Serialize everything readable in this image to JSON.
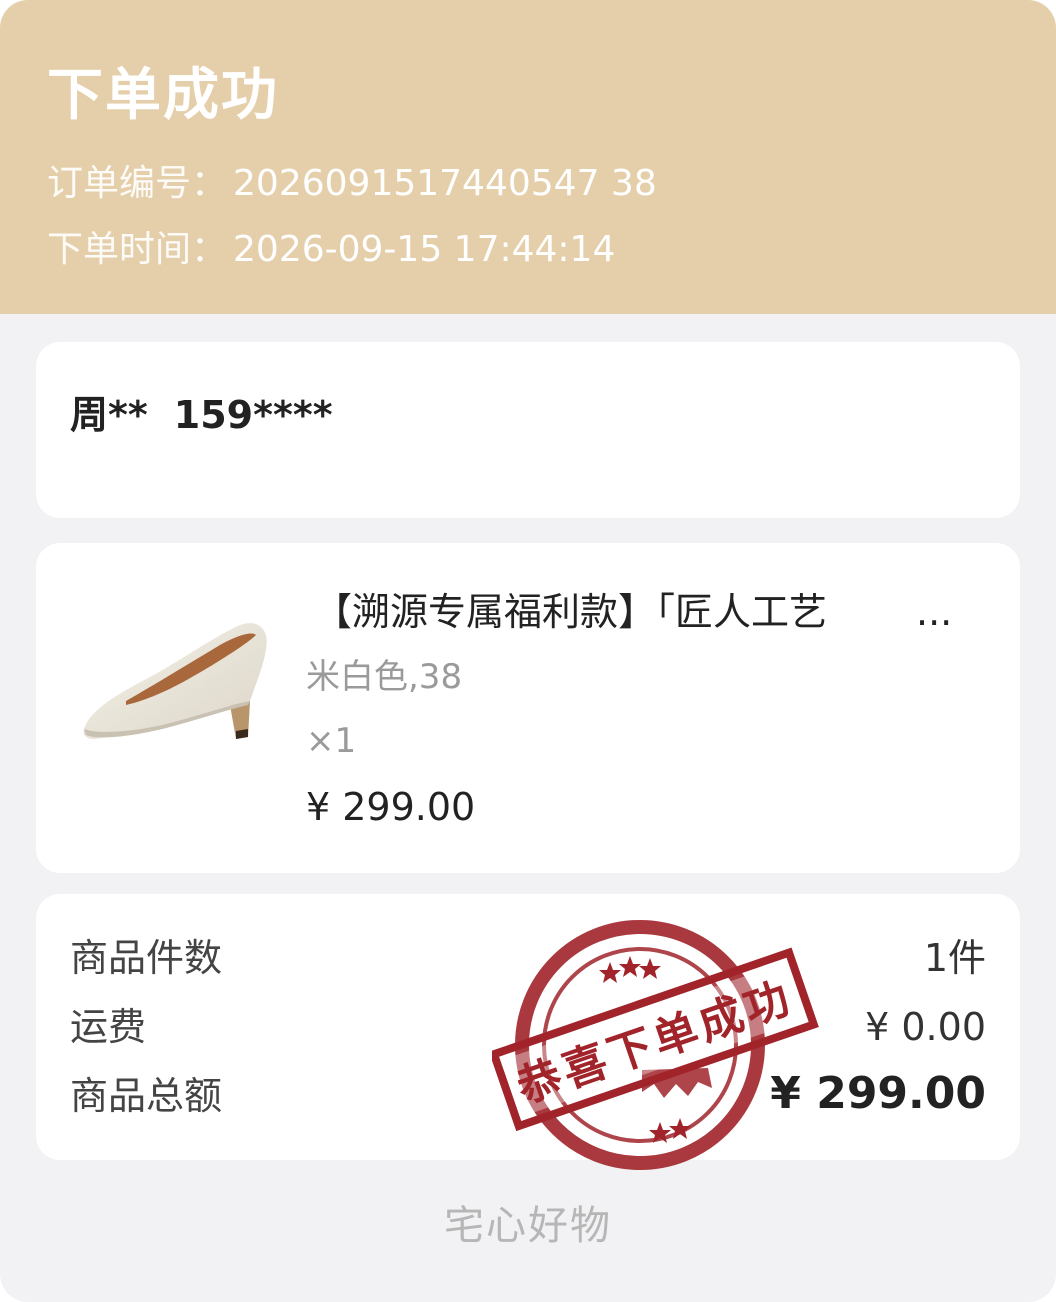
{
  "header": {
    "title": "下单成功",
    "order_number_label": "订单编号：",
    "order_number_value": "2026091517440547 38",
    "order_time_label": "下单时间：",
    "order_time_value": "2026-09-15 17:44:14"
  },
  "address": {
    "name": "周**",
    "phone": "159****"
  },
  "product": {
    "title": "【溯源专属福利款】「匠人工艺",
    "ellipsis": "...",
    "variant": "米白色,38",
    "quantity": "×1",
    "price": "¥ 299.00",
    "image_icon": "beige-pump-shoe"
  },
  "summary": {
    "item_count_label": "商品件数",
    "item_count_value": "1件",
    "shipping_label": "运费",
    "shipping_value": "¥ 0.00",
    "total_label": "商品总额",
    "total_value": "¥ 299.00"
  },
  "stamp": {
    "text": "恭喜下单成功"
  },
  "footer": {
    "brand": "宅心好物"
  },
  "colors": {
    "header_bg": "#e5cfaa",
    "page_bg": "#f2f2f4",
    "stamp_red": "#a0242a"
  }
}
